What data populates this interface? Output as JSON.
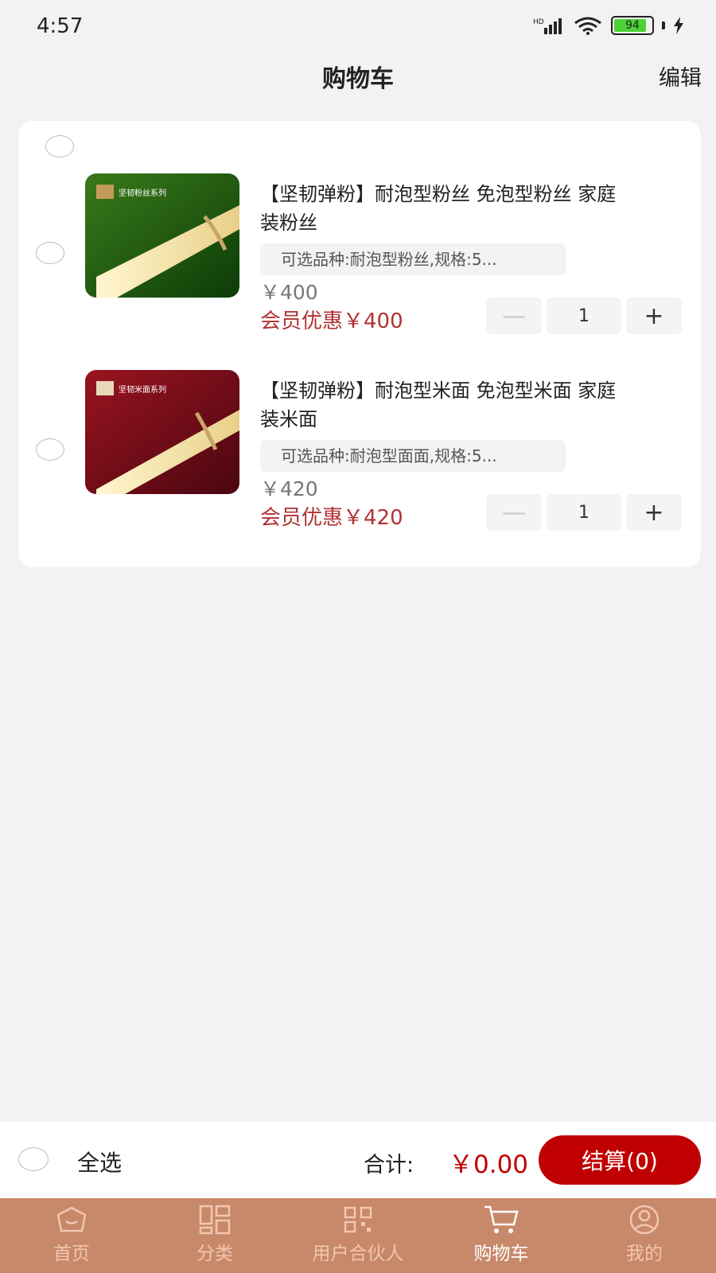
{
  "status_bar": {
    "time": "4:57",
    "battery": "94"
  },
  "header": {
    "title": "购物车",
    "edit": "编辑"
  },
  "cart": {
    "items": [
      {
        "title": "【坚韧弹粉】耐泡型粉丝 免泡型粉丝 家庭装粉丝",
        "spec": "可选品种:耐泡型粉丝,规格:5...",
        "price": "￥400",
        "member_price": "会员优惠￥400",
        "quantity": "1",
        "image_text": "坚韧粉丝系列",
        "image_colors": [
          "#2e6a14",
          "#0c3c08"
        ]
      },
      {
        "title": "【坚韧弹粉】耐泡型米面 免泡型米面 家庭装米面",
        "spec": "可选品种:耐泡型面面,规格:5...",
        "price": "￥420",
        "member_price": "会员优惠￥420",
        "quantity": "1",
        "image_text": "坚韧米面系列",
        "image_colors": [
          "#8a0f1a",
          "#4a0610"
        ]
      }
    ],
    "minus": "—",
    "plus": "+"
  },
  "footer": {
    "select_all": "全选",
    "total_label": "合计:",
    "total_value": "￥0.00",
    "checkout": "结算(0)"
  },
  "tabbar": {
    "tabs": [
      {
        "label": "首页",
        "icon": "home-icon"
      },
      {
        "label": "分类",
        "icon": "category-icon"
      },
      {
        "label": "用户合伙人",
        "icon": "qrcode-icon"
      },
      {
        "label": "购物车",
        "icon": "cart-icon",
        "active": true
      },
      {
        "label": "我的",
        "icon": "profile-icon"
      }
    ]
  },
  "colors": {
    "accent": "#c00000",
    "tabbar": "#c8886a",
    "member_price": "#b03232"
  }
}
